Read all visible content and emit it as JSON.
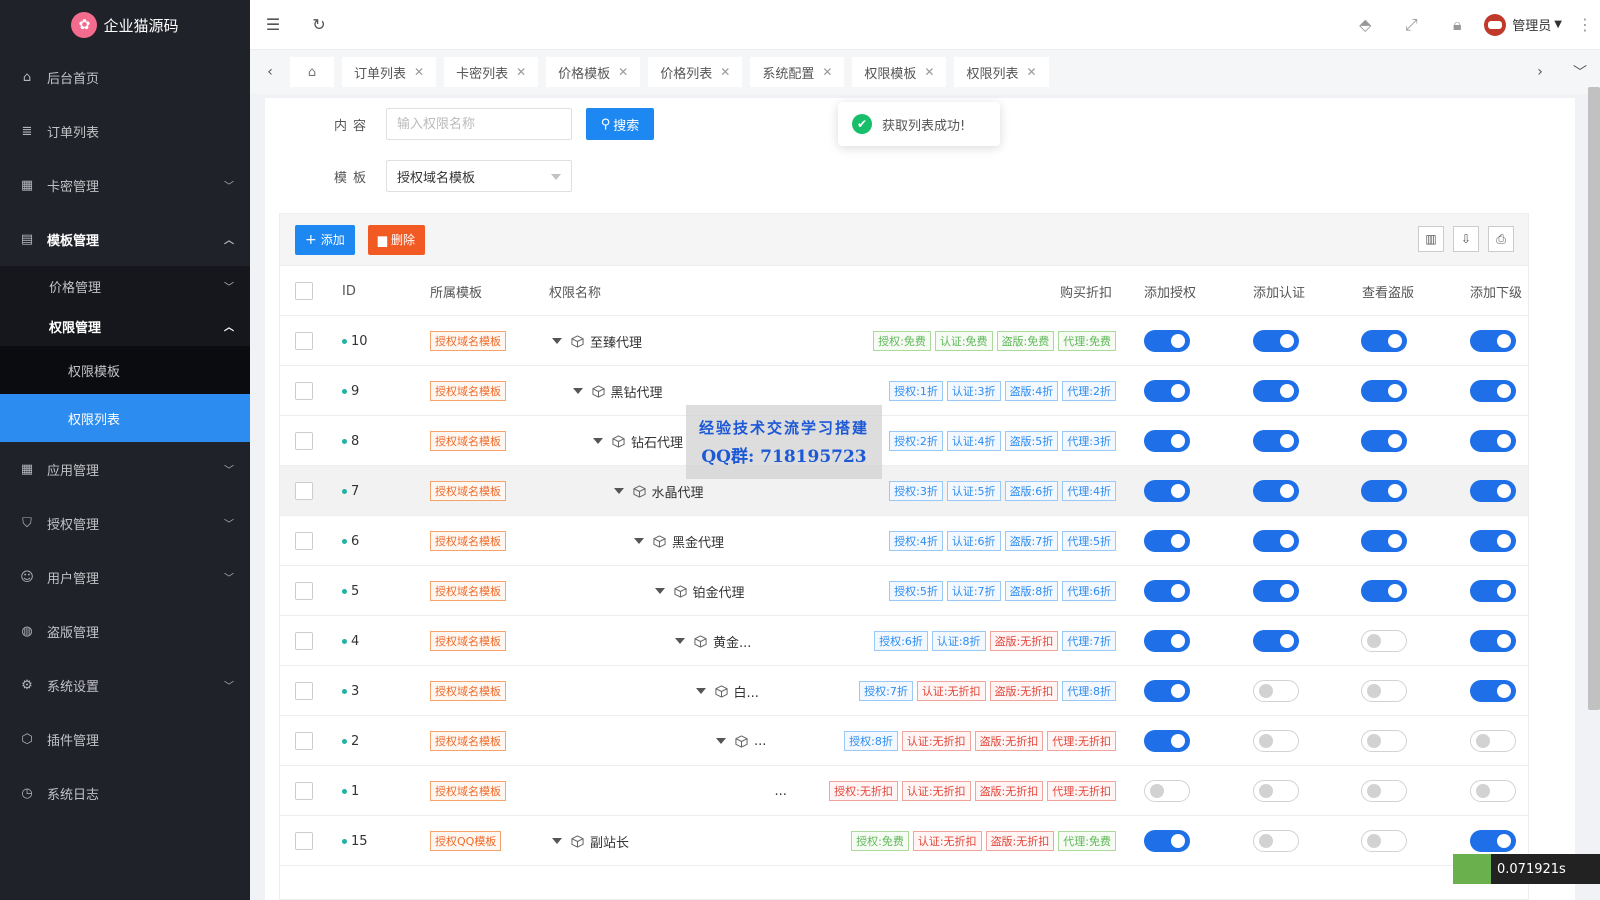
{
  "app": {
    "title": "企业猫源码"
  },
  "sidebar": {
    "items": [
      {
        "label": "后台首页"
      },
      {
        "label": "订单列表"
      },
      {
        "label": "卡密管理"
      },
      {
        "label": "模板管理"
      },
      {
        "label": "应用管理"
      },
      {
        "label": "授权管理"
      },
      {
        "label": "用户管理"
      },
      {
        "label": "盗版管理"
      },
      {
        "label": "系统设置"
      },
      {
        "label": "插件管理"
      },
      {
        "label": "系统日志"
      }
    ],
    "sub": {
      "price": "价格管理",
      "perm": "权限管理",
      "perm_template": "权限模板",
      "perm_list": "权限列表"
    }
  },
  "header": {
    "admin": "管理员"
  },
  "tabs": [
    "订单列表",
    "卡密列表",
    "价格模板",
    "价格列表",
    "系统配置",
    "权限模板",
    "权限列表"
  ],
  "search": {
    "content_label": "内容",
    "placeholder": "输入权限名称",
    "search_button": "搜索",
    "template_label": "模板",
    "template_value": "授权域名模板"
  },
  "toast": {
    "message": "获取列表成功!"
  },
  "toolbar": {
    "add": "添加",
    "delete": "删除"
  },
  "table": {
    "columns": [
      "ID",
      "所属模板",
      "权限名称",
      "购买折扣",
      "添加授权",
      "添加认证",
      "查看盗版",
      "添加下级"
    ],
    "rows": [
      {
        "id": "10",
        "template": "授权域名模板",
        "name": "至臻代理",
        "depth": 0,
        "tags": [
          [
            "授权:免费",
            "green"
          ],
          [
            "认证:免费",
            "green"
          ],
          [
            "盗版:免费",
            "green"
          ],
          [
            "代理:免费",
            "green"
          ]
        ],
        "sw": [
          true,
          true,
          true,
          true
        ]
      },
      {
        "id": "9",
        "template": "授权域名模板",
        "name": "黑钻代理",
        "depth": 1,
        "tags": [
          [
            "授权:1折",
            "blue"
          ],
          [
            "认证:3折",
            "blue"
          ],
          [
            "盗版:4折",
            "blue"
          ],
          [
            "代理:2折",
            "blue"
          ]
        ],
        "sw": [
          true,
          true,
          true,
          true
        ]
      },
      {
        "id": "8",
        "template": "授权域名模板",
        "name": "钻石代理",
        "depth": 2,
        "tags": [
          [
            "授权:2折",
            "blue"
          ],
          [
            "认证:4折",
            "blue"
          ],
          [
            "盗版:5折",
            "blue"
          ],
          [
            "代理:3折",
            "blue"
          ]
        ],
        "sw": [
          true,
          true,
          true,
          true
        ]
      },
      {
        "id": "7",
        "template": "授权域名模板",
        "name": "水晶代理",
        "depth": 3,
        "tags": [
          [
            "授权:3折",
            "blue"
          ],
          [
            "认证:5折",
            "blue"
          ],
          [
            "盗版:6折",
            "blue"
          ],
          [
            "代理:4折",
            "blue"
          ]
        ],
        "sw": [
          true,
          true,
          true,
          true
        ]
      },
      {
        "id": "6",
        "template": "授权域名模板",
        "name": "黑金代理",
        "depth": 4,
        "tags": [
          [
            "授权:4折",
            "blue"
          ],
          [
            "认证:6折",
            "blue"
          ],
          [
            "盗版:7折",
            "blue"
          ],
          [
            "代理:5折",
            "blue"
          ]
        ],
        "sw": [
          true,
          true,
          true,
          true
        ]
      },
      {
        "id": "5",
        "template": "授权域名模板",
        "name": "铂金代理",
        "depth": 5,
        "tags": [
          [
            "授权:5折",
            "blue"
          ],
          [
            "认证:7折",
            "blue"
          ],
          [
            "盗版:8折",
            "blue"
          ],
          [
            "代理:6折",
            "blue"
          ]
        ],
        "sw": [
          true,
          true,
          true,
          true
        ]
      },
      {
        "id": "4",
        "template": "授权域名模板",
        "name": "黄金...",
        "depth": 6,
        "tags": [
          [
            "授权:6折",
            "blue"
          ],
          [
            "认证:8折",
            "blue"
          ],
          [
            "盗版:无折扣",
            "red"
          ],
          [
            "代理:7折",
            "blue"
          ]
        ],
        "sw": [
          true,
          true,
          false,
          true
        ]
      },
      {
        "id": "3",
        "template": "授权域名模板",
        "name": "白...",
        "depth": 7,
        "tags": [
          [
            "授权:7折",
            "blue"
          ],
          [
            "认证:无折扣",
            "red"
          ],
          [
            "盗版:无折扣",
            "red"
          ],
          [
            "代理:8折",
            "blue"
          ]
        ],
        "sw": [
          true,
          false,
          false,
          true
        ]
      },
      {
        "id": "2",
        "template": "授权域名模板",
        "name": "...",
        "depth": 8,
        "tags": [
          [
            "授权:8折",
            "blue"
          ],
          [
            "认证:无折扣",
            "red"
          ],
          [
            "盗版:无折扣",
            "red"
          ],
          [
            "代理:无折扣",
            "red"
          ]
        ],
        "sw": [
          true,
          false,
          false,
          false
        ]
      },
      {
        "id": "1",
        "template": "授权域名模板",
        "name": "...",
        "depth": 9,
        "tags": [
          [
            "授权:无折扣",
            "red"
          ],
          [
            "认证:无折扣",
            "red"
          ],
          [
            "盗版:无折扣",
            "red"
          ],
          [
            "代理:无折扣",
            "red"
          ]
        ],
        "sw": [
          false,
          false,
          false,
          false
        ]
      },
      {
        "id": "15",
        "template": "授权QQ模板",
        "name": "副站长",
        "depth": 0,
        "tags": [
          [
            "授权:免费",
            "green"
          ],
          [
            "认证:无折扣",
            "red"
          ],
          [
            "盗版:无折扣",
            "red"
          ],
          [
            "代理:免费",
            "green"
          ]
        ],
        "sw": [
          true,
          false,
          false,
          true
        ]
      }
    ]
  },
  "watermark": {
    "line1": "经验技术交流学习搭建",
    "line2": "QQ群: 718195723"
  },
  "timer": {
    "value": "0.071921s"
  }
}
